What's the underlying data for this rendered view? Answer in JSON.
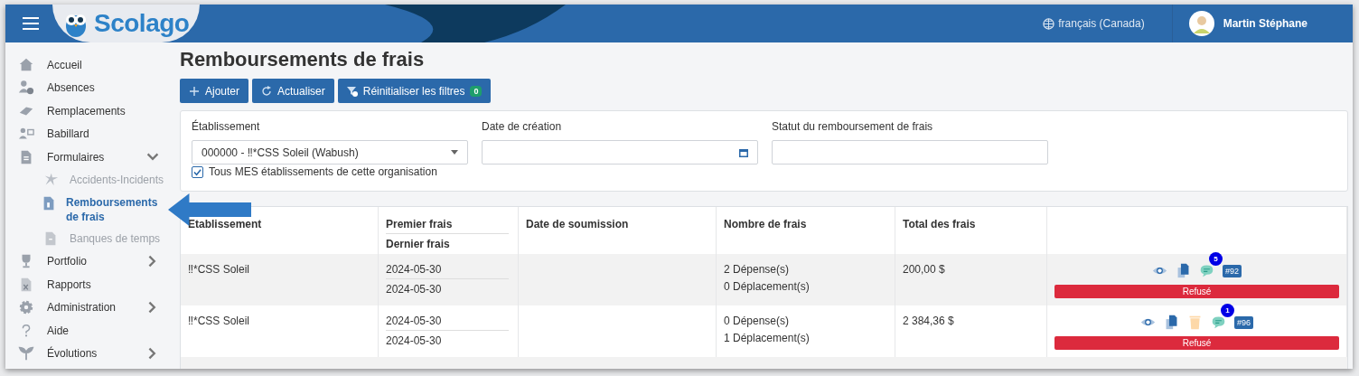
{
  "header": {
    "logo": "Scolago",
    "language": "français (Canada)",
    "user": "Martin Stéphane"
  },
  "sidebar": {
    "items": [
      {
        "label": "Accueil",
        "selected": false,
        "disabled": false
      },
      {
        "label": "Absences",
        "selected": false,
        "disabled": false
      },
      {
        "label": "Remplacements",
        "selected": false,
        "disabled": false
      },
      {
        "label": "Babillard",
        "selected": false,
        "disabled": false
      },
      {
        "label": "Formulaires",
        "selected": false,
        "disabled": false,
        "expanded": true,
        "children": [
          {
            "label": "Accidents-Incidents",
            "selected": false,
            "disabled": true
          },
          {
            "label": "Remboursements de frais",
            "selected": true,
            "disabled": false
          },
          {
            "label": "Banques de temps",
            "selected": false,
            "disabled": true
          }
        ]
      },
      {
        "label": "Portfolio",
        "selected": false,
        "disabled": false,
        "expanded": false
      },
      {
        "label": "Rapports",
        "selected": false,
        "disabled": false
      },
      {
        "label": "Administration",
        "selected": false,
        "disabled": false,
        "expanded": false
      },
      {
        "label": "Aide",
        "selected": false,
        "disabled": false
      },
      {
        "label": "Évolutions",
        "selected": false,
        "disabled": false,
        "expanded": false
      }
    ]
  },
  "page": {
    "title": "Remboursements de frais",
    "buttons": [
      {
        "kind": "add",
        "label": "Ajouter"
      },
      {
        "kind": "refresh",
        "label": "Actualiser"
      },
      {
        "kind": "reset",
        "label": "Réinitialiser les filtres",
        "count": "0"
      }
    ]
  },
  "filters": {
    "establishment": {
      "label": "Établissement",
      "value": "000000 - ‼*CSS Soleil (Wabush)"
    },
    "all_mine": {
      "label": "Tous MES établissements de cette organisation",
      "checked": true
    },
    "creation_date": {
      "label": "Date de création"
    },
    "status": {
      "label": "Statut du remboursement de frais"
    }
  },
  "table": {
    "columns": [
      "Etablissement",
      [
        "Premier frais",
        "Dernier frais"
      ],
      "Date de soumission",
      "Nombre de frais",
      "Total des frais"
    ],
    "rows": [
      {
        "establishment": "‼*CSS Soleil",
        "first": "2024-05-30",
        "last": "2024-05-30",
        "expenses": "2 Dépense(s)",
        "trips": "0 Déplacement(s)",
        "total": "200,00 $",
        "deletable": false,
        "comments": "5",
        "number": "#92",
        "status": "Refusé"
      },
      {
        "establishment": "‼*CSS Soleil",
        "first": "2024-05-30",
        "last": "2024-05-30",
        "expenses": "0 Dépense(s)",
        "trips": "1 Déplacement(s)",
        "total": "2 384,36 $",
        "deletable": true,
        "comments": "1",
        "number": "#96",
        "status": "Refusé"
      }
    ]
  }
}
